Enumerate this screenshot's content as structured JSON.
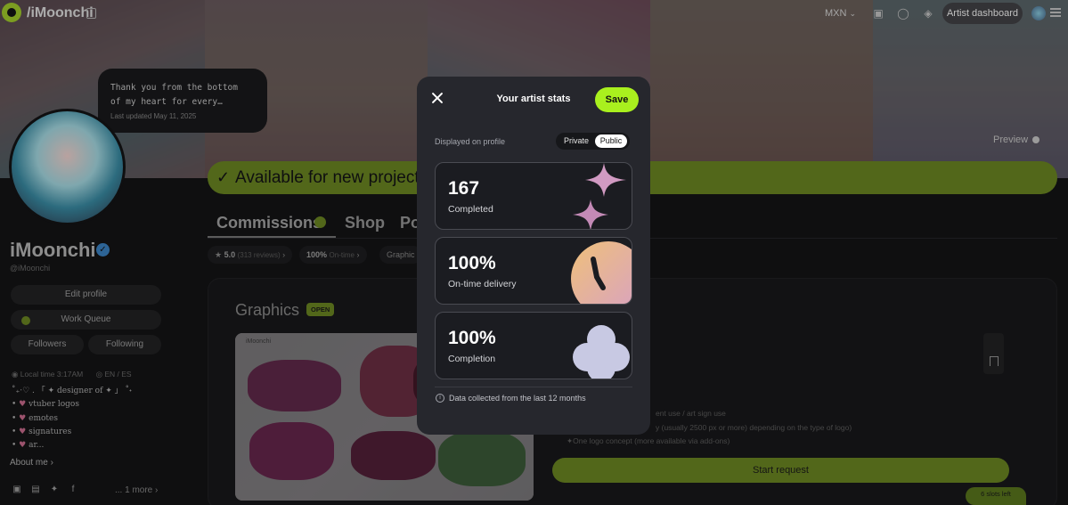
{
  "topbar": {
    "username": "/iMoonchi",
    "currency": "MXN",
    "dashboard_label": "Artist dashboard"
  },
  "status_bubble": {
    "message_line1": "Thank you from the bottom",
    "message_line2": "of my heart for every…",
    "updated": "Last updated May 11, 2025"
  },
  "preview_label": "Preview",
  "availability": "Available for new projects",
  "profile": {
    "name": "iMoonchi",
    "handle": "@iMoonchi",
    "edit_profile": "Edit profile",
    "work_queue": "Work Queue",
    "followers": "Followers",
    "following": "Following",
    "local_time": "Local time 3:17AM",
    "languages": "EN / ES",
    "bio": [
      "˚₊‧♡ . 「 ✦ designer of ✦ 」 ˚˖",
      "vtuber logos",
      "emotes",
      "signatures",
      "ar..."
    ],
    "about_me": "About me",
    "more": "... 1 more"
  },
  "tabs": {
    "commissions": "Commissions",
    "shop": "Shop",
    "portfolio_partial": "Po"
  },
  "chips": {
    "rating": "5.0",
    "reviews": "(313 reviews)",
    "ontime": "100%",
    "ontime_label": "On-time",
    "graphics": "Graphic"
  },
  "commission_card": {
    "title": "Graphics",
    "badge": "OPEN",
    "art_label": "iMoonchi",
    "desc_line1": "ent use / art sign use",
    "desc_line2": "y (usually 2500 px or more) depending on the type of logo)",
    "desc_line3": "✦One logo concept (more available via add-ons)",
    "start_request": "Start request",
    "slots_left": "6 slots left"
  },
  "modal": {
    "title": "Your artist stats",
    "save": "Save",
    "displayed_on_profile": "Displayed on profile",
    "toggle_private": "Private",
    "toggle_public": "Public",
    "stats": [
      {
        "value": "167",
        "label": "Completed",
        "icon": "sparkle-icon"
      },
      {
        "value": "100%",
        "label": "On-time delivery",
        "icon": "clock-icon"
      },
      {
        "value": "100%",
        "label": "Completion",
        "icon": "flower-icon"
      }
    ],
    "info": "Data collected from the last 12 months"
  },
  "colors": {
    "accent": "#a9f01e",
    "modal_bg": "#26272d",
    "page_bg": "#141416",
    "muted_green": "#6e8a23"
  }
}
